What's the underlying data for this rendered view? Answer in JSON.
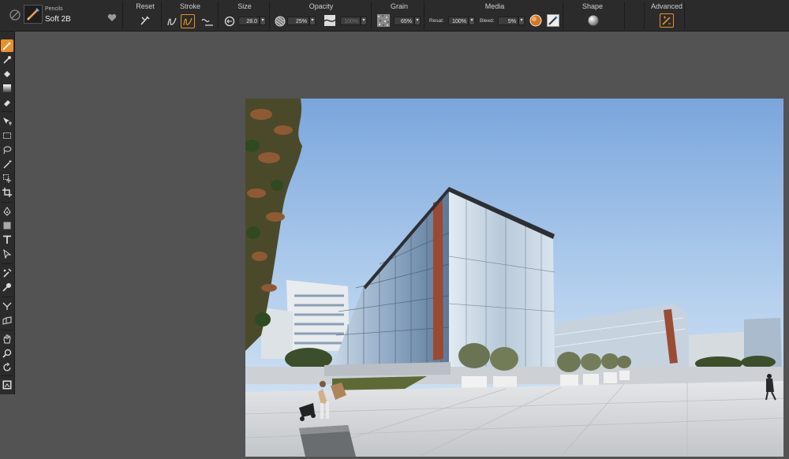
{
  "brush": {
    "category": "Pencils",
    "variant": "Soft 2B"
  },
  "groups": {
    "reset": "Reset",
    "stroke": "Stroke",
    "size": "Size",
    "opacity": "Opacity",
    "grain": "Grain",
    "media": "Media",
    "shape": "Shape",
    "advanced": "Advanced"
  },
  "values": {
    "size": "28.0",
    "opacity": "25%",
    "opacity_expression": "100%",
    "grain": "65%",
    "resat_label": "Resat:",
    "resat": "100%",
    "bleed_label": "Bleed:",
    "bleed": "5%"
  },
  "colors": {
    "accent": "#e8912c",
    "panel": "#2b2b2b",
    "canvas_bg": "#535353"
  },
  "tools": [
    "brush-icon",
    "dropper-icon",
    "paint-bucket-icon",
    "gradient-icon",
    "eraser-icon",
    "transform-icon",
    "rect-select-icon",
    "lasso-icon",
    "magic-wand-icon",
    "selection-adjust-icon",
    "crop-icon",
    "pen-icon",
    "shape-icon",
    "text-icon",
    "shape-select-icon",
    "cloner-icon",
    "rubber-stamp-icon",
    "mirror-icon",
    "perspective-icon",
    "grabber-icon",
    "magnifier-icon",
    "rotate-page-icon",
    "color-swatch-icon"
  ]
}
